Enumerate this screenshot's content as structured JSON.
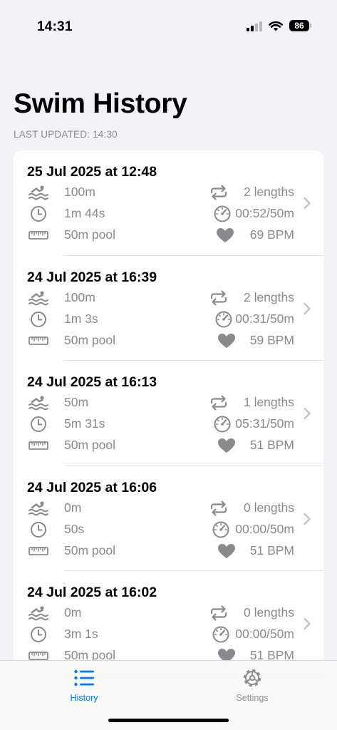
{
  "status_bar": {
    "time": "14:31",
    "battery": "86"
  },
  "header": {
    "title": "Swim History",
    "last_updated": "LAST UPDATED: 14:30"
  },
  "sessions": [
    {
      "date": "25 Jul 2025 at 12:48",
      "distance": "100m",
      "lengths": "2 lengths",
      "duration": "1m 44s",
      "pace": "00:52/50m",
      "pool": "50m pool",
      "heart_rate": "69 BPM"
    },
    {
      "date": "24 Jul 2025 at 16:39",
      "distance": "100m",
      "lengths": "2 lengths",
      "duration": "1m 3s",
      "pace": "00:31/50m",
      "pool": "50m pool",
      "heart_rate": "59 BPM"
    },
    {
      "date": "24 Jul 2025 at 16:13",
      "distance": "50m",
      "lengths": "1 lengths",
      "duration": "5m 31s",
      "pace": "05:31/50m",
      "pool": "50m pool",
      "heart_rate": "51 BPM"
    },
    {
      "date": "24 Jul 2025 at 16:06",
      "distance": "0m",
      "lengths": "0 lengths",
      "duration": "50s",
      "pace": "00:00/50m",
      "pool": "50m pool",
      "heart_rate": "51 BPM"
    },
    {
      "date": "24 Jul 2025 at 16:02",
      "distance": "0m",
      "lengths": "0 lengths",
      "duration": "3m 1s",
      "pace": "00:00/50m",
      "pool": "50m pool",
      "heart_rate": "51 BPM"
    }
  ],
  "icons": {
    "distance": "swimmer-icon",
    "lengths": "repeat-icon",
    "duration": "clock-icon",
    "pace": "speedometer-icon",
    "pool": "ruler-icon",
    "heart_rate": "heart-icon",
    "row_action": "chevron-right-icon"
  },
  "tab_bar": {
    "tabs": [
      {
        "label": "History",
        "icon": "list-icon",
        "active": true
      },
      {
        "label": "Settings",
        "icon": "gear-icon",
        "active": false
      }
    ]
  },
  "colors": {
    "accent": "#007aff",
    "secondary_text": "#8a8a8e",
    "icon_gray": "#8a8a8e",
    "inactive_tab": "#8e8e93",
    "background": "#f2f2f7"
  }
}
